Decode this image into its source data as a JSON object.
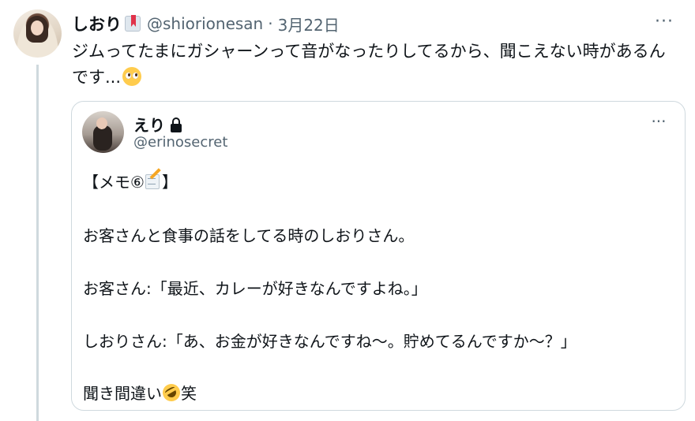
{
  "tweet": {
    "author_name": "しおり",
    "handle": "@shiorionesan",
    "separator": "·",
    "date": "3月22日",
    "more_label": "···",
    "text": "ジムってたまにガシャーンって音がなったりしてるから、聞こえない時があるんです...",
    "emoji": "pleading-face"
  },
  "quoted_tweet": {
    "author_name": "えり",
    "handle": "@erinosecret",
    "more_label": "···",
    "lines": {
      "memo_start": "【メモ⑥",
      "memo_end": "】",
      "line1": "お客さんと食事の話をしてる時のしおりさん。",
      "line2": "お客さん:「最近、カレーが好きなんですよね。」",
      "line3": "しおりさん:「あ、お金が好きなんですね〜。貯めてるんですか〜？」",
      "line4_start": "聞き間違い",
      "line4_end": "笑"
    }
  },
  "colors": {
    "text_primary": "#0f1419",
    "text_secondary": "#536471",
    "border": "#cfd9de",
    "background": "#ffffff"
  }
}
